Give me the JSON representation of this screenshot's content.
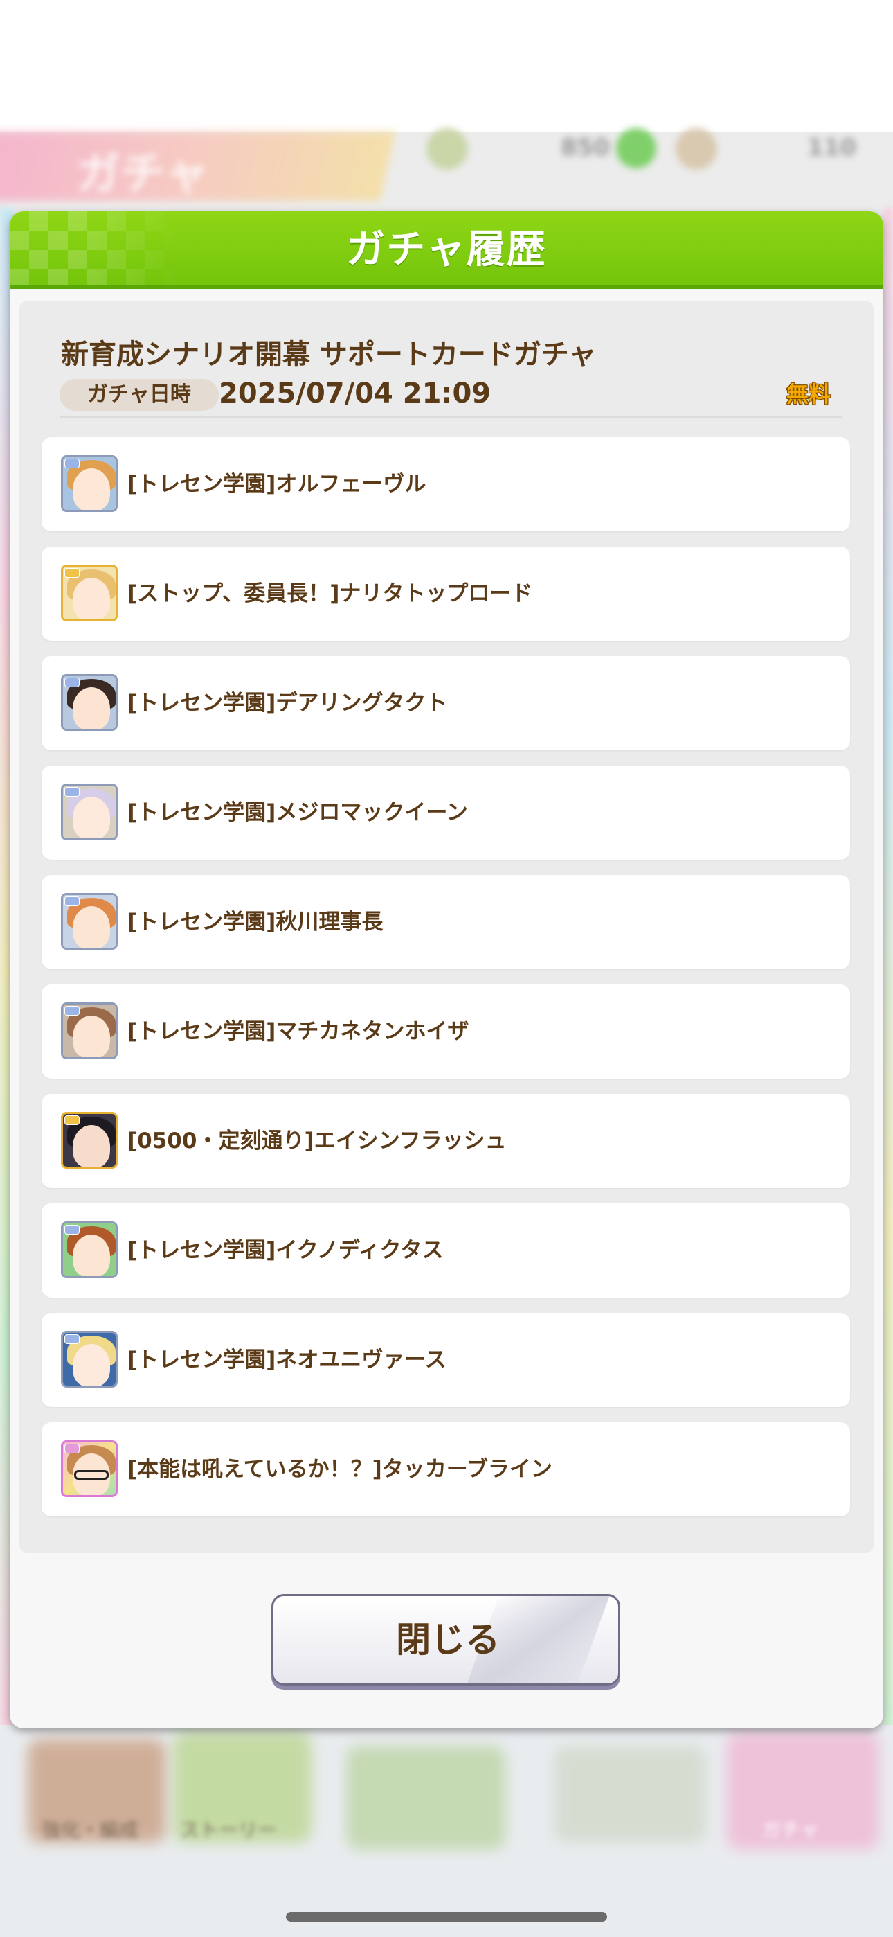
{
  "background": {
    "tab_label": "ガチャ",
    "header_value_1": "850",
    "header_value_2": "110",
    "bottom_labels": [
      "強化・編成",
      "ストーリー",
      "",
      "",
      "ガチャ"
    ]
  },
  "modal": {
    "title": "ガチャ履歴",
    "gacha_name": "新育成シナリオ開幕 サポートカードガチャ",
    "date_label": "ガチャ日時",
    "date_value": "2025/07/04 21:09",
    "free_badge": "無料",
    "items": [
      {
        "label": "[トレセン学園]オルフェーヴル",
        "rarity": "R",
        "icon": "card-icon-orfevre"
      },
      {
        "label": "[ストップ、委員長！]ナリタトップロード",
        "rarity": "SR",
        "icon": "card-icon-narita-top-road"
      },
      {
        "label": "[トレセン学園]デアリングタクト",
        "rarity": "R",
        "icon": "card-icon-daring-tact"
      },
      {
        "label": "[トレセン学園]メジロマックイーン",
        "rarity": "R",
        "icon": "card-icon-mejiro-mcqueen"
      },
      {
        "label": "[トレセン学園]秋川理事長",
        "rarity": "R",
        "icon": "card-icon-akikawa"
      },
      {
        "label": "[トレセン学園]マチカネタンホイザ",
        "rarity": "R",
        "icon": "card-icon-matikanetannhauser"
      },
      {
        "label": "[0500・定刻通り]エイシンフラッシュ",
        "rarity": "SR",
        "icon": "card-icon-eishin-flash"
      },
      {
        "label": "[トレセン学園]イクノディクタス",
        "rarity": "R",
        "icon": "card-icon-ikuno-dictus"
      },
      {
        "label": "[トレセン学園]ネオユニヴァース",
        "rarity": "R",
        "icon": "card-icon-neo-universe"
      },
      {
        "label": "[本能は吼えているか！？]タッカーブライン",
        "rarity": "SSR",
        "icon": "card-icon-tucker-bryne"
      }
    ],
    "close_label": "閉じる"
  },
  "colors": {
    "header_green": "#7dcb10",
    "text_brown": "#5b3a17",
    "free_orange": "#f5a800"
  }
}
